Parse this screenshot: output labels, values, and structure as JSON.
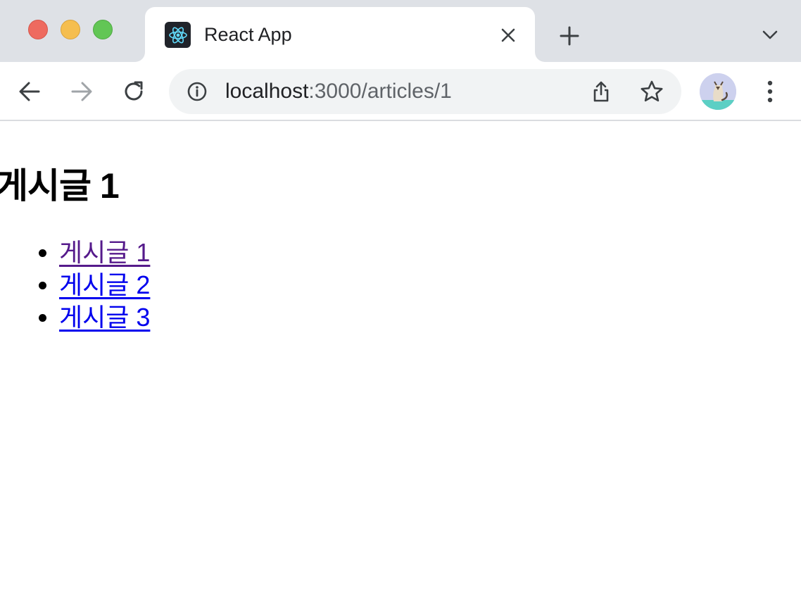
{
  "window": {
    "controls": [
      "close",
      "minimize",
      "maximize"
    ]
  },
  "tab": {
    "title": "React App",
    "favicon": "react-logo-icon"
  },
  "toolbar": {
    "url_host": "localhost",
    "url_path": ":3000/articles/1"
  },
  "page": {
    "heading": "게시글 1",
    "articles": [
      {
        "label": "게시글 1",
        "visited": true
      },
      {
        "label": "게시글 2",
        "visited": false
      },
      {
        "label": "게시글 3",
        "visited": false
      }
    ]
  },
  "colors": {
    "tabstrip": "#dee1e6",
    "visited_link": "#551a8b",
    "link": "#0000ee",
    "react_blue": "#61dafb"
  }
}
